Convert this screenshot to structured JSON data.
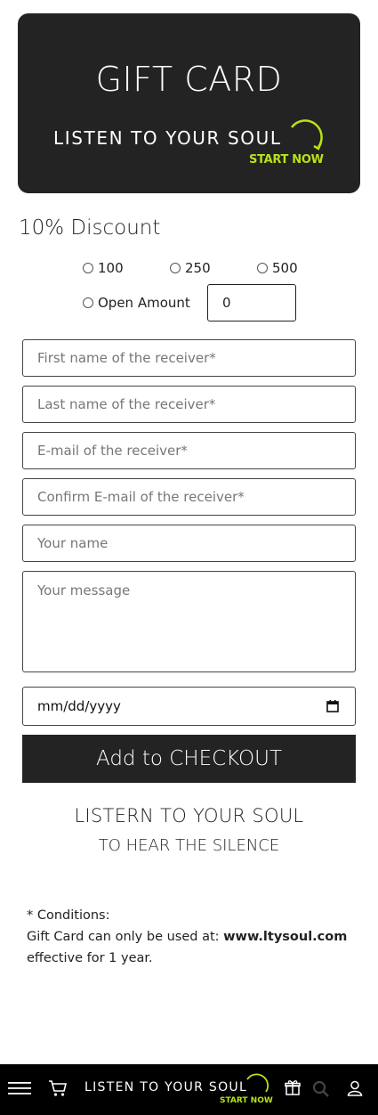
{
  "card": {
    "title": "GIFT CARD",
    "logo_text": "LISTEN TO YOUR SOUL",
    "logo_sub": "START NOW"
  },
  "discount_label": "10% Discount",
  "amount_options": [
    {
      "label": "100",
      "selected": false
    },
    {
      "label": "250",
      "selected": false
    },
    {
      "label": "500",
      "selected": false
    },
    {
      "label": "Open Amount",
      "selected": false
    }
  ],
  "open_amount_value": "0",
  "form": {
    "first_name_placeholder": "First name of the receiver*",
    "last_name_placeholder": "Last name of the receiver*",
    "email_placeholder": "E-mail of the receiver*",
    "confirm_email_placeholder": "Confirm E-mail of the receiver*",
    "your_name_placeholder": "Your name",
    "message_placeholder": "Your message",
    "date_placeholder": "mm/dd/yyyy"
  },
  "checkout_label": "Add to CHECKOUT",
  "slogan": {
    "line1": "LISTERN TO YOUR SOUL",
    "line2": "TO HEAR THE SILENCE"
  },
  "conditions": {
    "heading": "* Conditions:",
    "line1_prefix": "Gift Card can only be used at: ",
    "site": "www.ltysoul.com",
    "line2": "effective for 1 year."
  },
  "bottom_bar": {
    "logo_text": "LISTEN TO YOUR SOUL",
    "logo_sub": "START NOW",
    "icons": [
      "menu-icon",
      "cart-icon",
      "gift-icon",
      "search-icon",
      "user-icon"
    ]
  },
  "colors": {
    "dark": "#232323",
    "accent": "#b8e216",
    "bar": "#000000"
  }
}
